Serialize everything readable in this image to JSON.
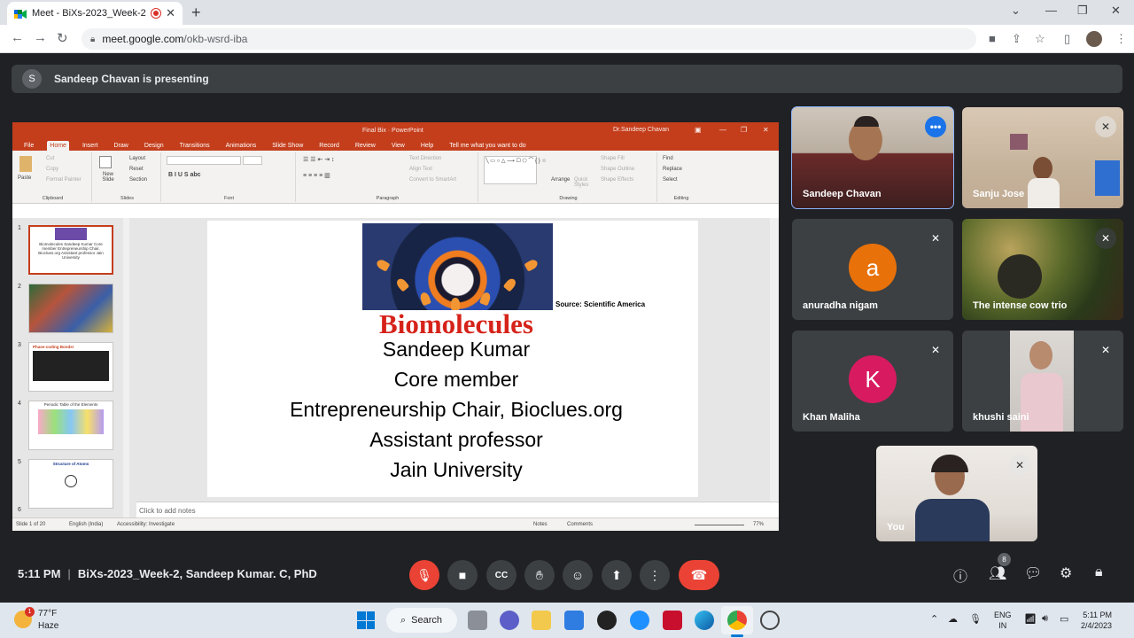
{
  "browser": {
    "tab_title": "Meet - BiXs-2023_Week-2, S",
    "url_host": "meet.google.com",
    "url_path": "/okb-wsrd-iba"
  },
  "meet": {
    "presenter_initial": "S",
    "presenting_text": "Sandeep Chavan is presenting",
    "time": "5:11 PM",
    "meeting_title": "BiXs-2023_Week-2, Sandeep Kumar. C, PhD",
    "participant_count": "8"
  },
  "ppt": {
    "window_title": "Final Bix  ·  PowerPoint",
    "user": "Dr.Sandeep Chavan",
    "menu": [
      "File",
      "Home",
      "Insert",
      "Draw",
      "Design",
      "Transitions",
      "Animations",
      "Slide Show",
      "Record",
      "Review",
      "View",
      "Help",
      "Tell me what you want to do"
    ],
    "ribbon": {
      "paste": "Paste",
      "cut": "Cut",
      "copy": "Copy",
      "format_painter": "Format Painter",
      "clipboard": "Clipboard",
      "new_slide": "New Slide",
      "layout": "Layout",
      "reset": "Reset",
      "section": "Section",
      "slides": "Slides",
      "font": "Font",
      "paragraph": "Paragraph",
      "text_direction": "Text Direction",
      "align_text": "Align Text",
      "convert_smartart": "Convert to SmartArt",
      "arrange": "Arrange",
      "quick_styles": "Quick Styles",
      "shape_fill": "Shape Fill",
      "shape_outline": "Shape Outline",
      "shape_effects": "Shape Effects",
      "drawing": "Drawing",
      "find": "Find",
      "replace": "Replace",
      "select": "Select",
      "editing": "Editing"
    },
    "thumbs": [
      {
        "num": "1",
        "text": "Biomolecules Sandeep Kumar Core member Entrepreneurship Chair, Bioclues.org Assistant professor Jain University"
      },
      {
        "num": "2",
        "text": ""
      },
      {
        "num": "3",
        "text": "Phase-coding Bonds!"
      },
      {
        "num": "4",
        "text": "Periodic Table of the Elements"
      },
      {
        "num": "5",
        "text": "Structure of Atoms"
      },
      {
        "num": "6",
        "text": ""
      }
    ],
    "slide": {
      "source": "Source: Scientific America",
      "heading": "Biomolecules",
      "lines": [
        "Sandeep Kumar",
        "Core member",
        "Entrepreneurship Chair, Bioclues.org",
        "Assistant professor",
        "Jain University"
      ]
    },
    "notes_placeholder": "Click to add notes",
    "status": {
      "slide": "Slide 1 of 20",
      "lang": "English (India)",
      "accessibility": "Accessibility: Investigate",
      "notes": "Notes",
      "comments": "Comments",
      "zoom": "77%"
    }
  },
  "participants": [
    {
      "name": "Sandeep Chavan"
    },
    {
      "name": "Sanju Jose"
    },
    {
      "name": "anuradha nigam",
      "initial": "a",
      "color": "#e8710a"
    },
    {
      "name": "The intense cow trio"
    },
    {
      "name": "Khan Maliha",
      "initial": "K",
      "color": "#d81b60"
    },
    {
      "name": "khushi saini"
    },
    {
      "name": "You"
    }
  ],
  "taskbar": {
    "weather_badge": "1",
    "temp": "77°F",
    "condition": "Haze",
    "search": "Search",
    "lang_1": "ENG",
    "lang_2": "IN",
    "time": "5:11 PM",
    "date": "2/4/2023"
  }
}
